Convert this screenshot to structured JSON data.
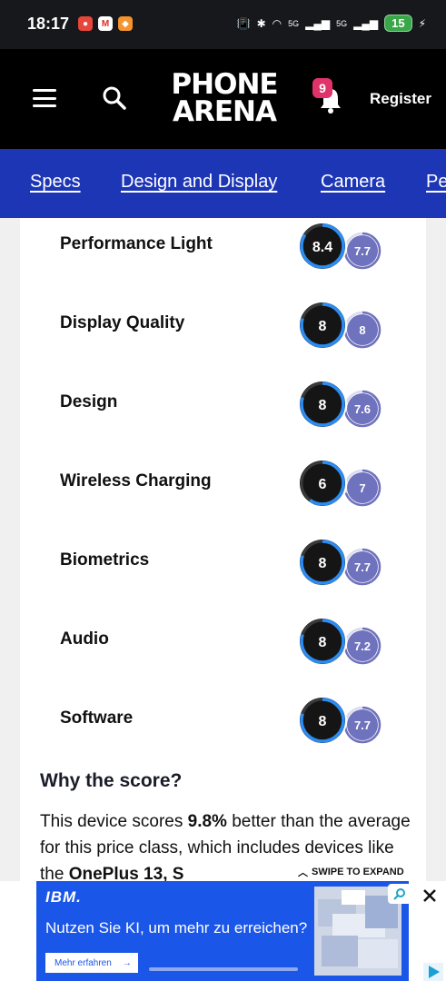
{
  "status_bar": {
    "time": "18:17",
    "apps": [
      {
        "icon": "chrome-icon",
        "color": "#e8463b",
        "glyph": "◉"
      },
      {
        "icon": "gmail-icon",
        "color": "#ffffff",
        "glyph": "M"
      },
      {
        "icon": "app-icon",
        "color": "#f5932f",
        "glyph": "◆"
      }
    ],
    "network_5g_1": "5G",
    "network_5g_2": "5G",
    "battery": "15"
  },
  "header": {
    "logo_line1": "PHONE",
    "logo_line2": "ARENA",
    "notification_count": "9",
    "register_label": "Register"
  },
  "tabs": [
    {
      "label": "Specs"
    },
    {
      "label": "Design and Display"
    },
    {
      "label": "Camera"
    },
    {
      "label": "Pe"
    }
  ],
  "ratings": [
    {
      "label": "Performance Light",
      "score": "8.4",
      "score_fraction": 0.84,
      "avg": "7.7",
      "avg_fraction": 0.77
    },
    {
      "label": "Display Quality",
      "score": "8",
      "score_fraction": 0.8,
      "avg": "8",
      "avg_fraction": 0.8
    },
    {
      "label": "Design",
      "score": "8",
      "score_fraction": 0.8,
      "avg": "7.6",
      "avg_fraction": 0.76
    },
    {
      "label": "Wireless Charging",
      "score": "6",
      "score_fraction": 0.6,
      "avg": "7",
      "avg_fraction": 0.7
    },
    {
      "label": "Biometrics",
      "score": "8",
      "score_fraction": 0.8,
      "avg": "7.7",
      "avg_fraction": 0.77
    },
    {
      "label": "Audio",
      "score": "8",
      "score_fraction": 0.8,
      "avg": "7.2",
      "avg_fraction": 0.72
    },
    {
      "label": "Software",
      "score": "8",
      "score_fraction": 0.8,
      "avg": "7.7",
      "avg_fraction": 0.77
    }
  ],
  "why_score": {
    "title": "Why the score?",
    "text_prefix": "This device scores ",
    "percent": "9.8%",
    "text_middle": " better than the average for this price class, which includes devices like the ",
    "device": "OnePlus 13, S"
  },
  "swipe_label": "SWIPE TO EXPAND",
  "ad": {
    "brand": "IBM.",
    "headline": "Nutzen Sie KI, um mehr zu erreichen?",
    "cta": "Mehr erfahren",
    "cta_arrow": "→"
  },
  "colors": {
    "nav_blue": "#1d36b6",
    "score_ring": "#2b8cf2",
    "avg_fill": "#6f72bd",
    "ad_blue": "#1a56e8"
  }
}
